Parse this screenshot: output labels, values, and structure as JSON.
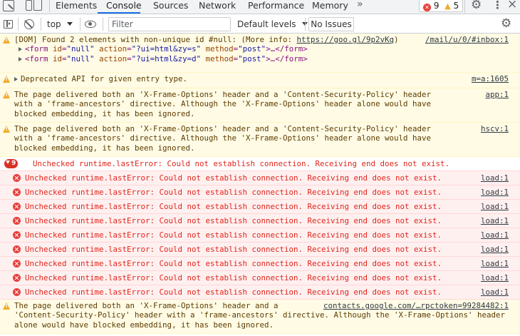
{
  "tabs": [
    {
      "label": "Elements"
    },
    {
      "label": "Console"
    },
    {
      "label": "Sources"
    },
    {
      "label": "Network"
    },
    {
      "label": "Performance"
    },
    {
      "label": "Memory"
    }
  ],
  "more_tabs": "»",
  "counts": {
    "errors": "9",
    "warnings": "5"
  },
  "toolbar": {
    "context": "top",
    "filter_placeholder": "Filter",
    "levels": "Default levels",
    "issues": "No Issues"
  },
  "messages": {
    "m1": {
      "text": "[DOM] Found 2 elements with non-unique id #null: (More info: ",
      "link": "https://goo.gl/9p2vKq",
      "text_end": ")",
      "source": "/mail/u/0/#inbox:1",
      "nodes": [
        {
          "open": "<form ",
          "a1": "id",
          "v1": "\"null\"",
          "a2": "action",
          "v2": "\"?ui=html&zy=s\"",
          "a3": "method",
          "v3": "\"post\"",
          "close": ">…</form>"
        },
        {
          "open": "<form ",
          "a1": "id",
          "v1": "\"null\"",
          "a2": "action",
          "v2": "\"?ui=html&zy=d\"",
          "a3": "method",
          "v3": "\"post\"",
          "close": ">…</form>"
        }
      ]
    },
    "m2": {
      "text": "Deprecated API for given entry type.",
      "source": "m=a:1605"
    },
    "m3": {
      "text": "The page delivered both an 'X-Frame-Options' header and a 'Content-Security-Policy' header with a 'frame-ancestors' directive. Although the 'X-Frame-Options' header alone would have blocked embedding, it has been ignored.",
      "source": "app:1"
    },
    "m4": {
      "text": "The page delivered both an 'X-Frame-Options' header and a 'Content-Security-Policy' header with a 'frame-ancestors' directive. Although the 'X-Frame-Options' header alone would have blocked embedding, it has been ignored.",
      "source": "hscv:1"
    },
    "group": {
      "count": "9",
      "text": "Unchecked runtime.lastError: Could not establish connection. Receiving end does not exist."
    },
    "children": [
      {
        "text": "Unchecked runtime.lastError: Could not establish connection. Receiving end does not exist.",
        "source": "load:1"
      },
      {
        "text": "Unchecked runtime.lastError: Could not establish connection. Receiving end does not exist.",
        "source": "load:1"
      },
      {
        "text": "Unchecked runtime.lastError: Could not establish connection. Receiving end does not exist.",
        "source": "load:1"
      },
      {
        "text": "Unchecked runtime.lastError: Could not establish connection. Receiving end does not exist.",
        "source": "load:1"
      },
      {
        "text": "Unchecked runtime.lastError: Could not establish connection. Receiving end does not exist.",
        "source": "load:1"
      },
      {
        "text": "Unchecked runtime.lastError: Could not establish connection. Receiving end does not exist.",
        "source": "load:1"
      },
      {
        "text": "Unchecked runtime.lastError: Could not establish connection. Receiving end does not exist.",
        "source": "load:1"
      },
      {
        "text": "Unchecked runtime.lastError: Could not establish connection. Receiving end does not exist.",
        "source": "load:1"
      },
      {
        "text": "Unchecked runtime.lastError: Could not establish connection. Receiving end does not exist.",
        "source": "load:1"
      }
    ],
    "m_last": {
      "text": "The page delivered both an 'X-Frame-Options' header and a 'Content-Security-Policy' header with a 'frame-ancestors' directive. Although the 'X-Frame-Options' header alone would have blocked embedding, it has been ignored.",
      "source": "contacts.google.com/…rpctoken=99284482:1"
    }
  },
  "colors": {
    "accent": "#1a73e8",
    "error": "#e0251b",
    "warning": "#f2ab26",
    "warn_bg": "#fffbe5",
    "error_bg": "#fff0f0"
  }
}
